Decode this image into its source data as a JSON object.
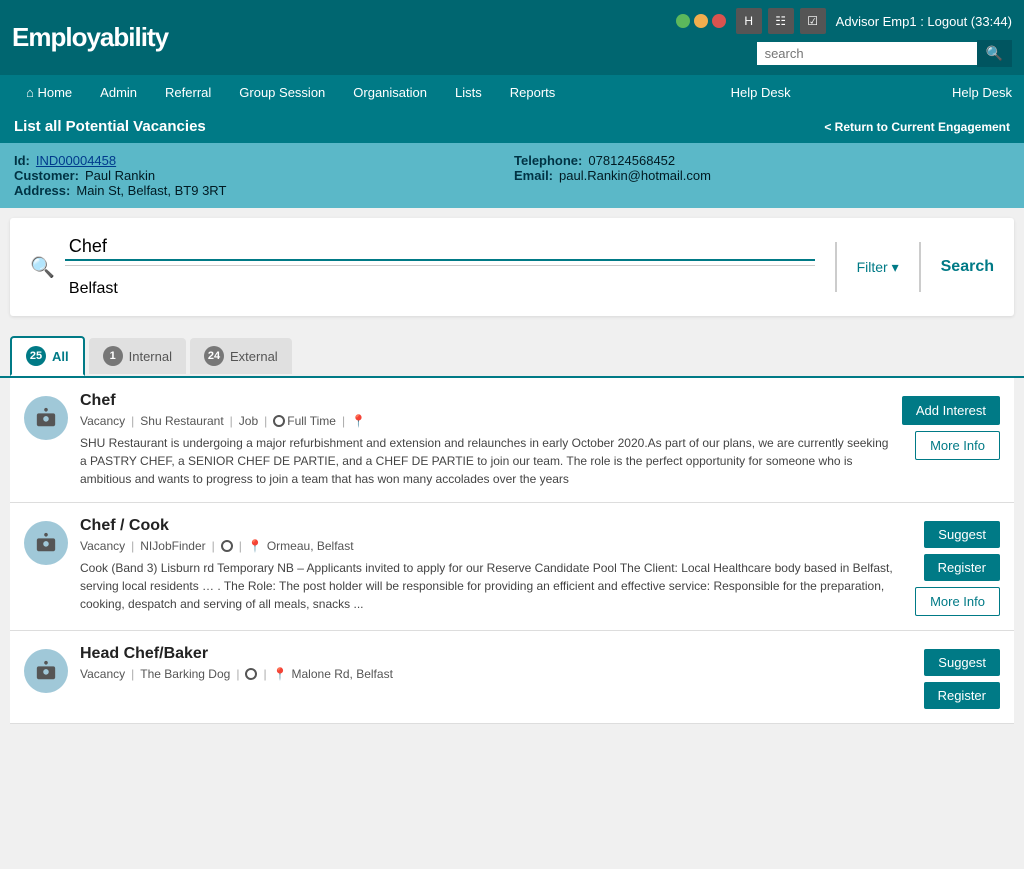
{
  "app": {
    "logo": "Employability",
    "traffic_lights": [
      "green",
      "yellow",
      "red"
    ],
    "header_icons": [
      "H",
      "doc",
      "check"
    ],
    "advisor": "Advisor Emp1 : Logout (33:44)",
    "search_placeholder": "search"
  },
  "nav": {
    "home": "Home",
    "items": [
      "Admin",
      "Referral",
      "Group Session",
      "Organisation",
      "Lists",
      "Reports"
    ],
    "help": "Help Desk"
  },
  "page": {
    "title": "List all Potential Vacancies",
    "return_link": "< Return to Current Engagement"
  },
  "customer": {
    "id_label": "Id:",
    "id_value": "IND00004458",
    "customer_label": "Customer:",
    "customer_value": "Paul Rankin",
    "address_label": "Address:",
    "address_value": "Main St, Belfast, BT9 3RT",
    "telephone_label": "Telephone:",
    "telephone_value": "078124568452",
    "email_label": "Email:",
    "email_value": "paul.Rankin@hotmail.com"
  },
  "search": {
    "job_value": "Chef",
    "location_value": "Belfast",
    "filter_label": "Filter ▾",
    "search_label": "Search"
  },
  "tabs": [
    {
      "badge": "25",
      "label": "All",
      "active": true
    },
    {
      "badge": "1",
      "label": "Internal",
      "active": false
    },
    {
      "badge": "24",
      "label": "External",
      "active": false
    }
  ],
  "vacancies": [
    {
      "title": "Chef",
      "meta_type": "Vacancy",
      "meta_source": "Shu Restaurant",
      "meta_kind": "Job",
      "meta_hours": "Full Time",
      "description": "SHU Restaurant is undergoing a major refurbishment and extension and relaunches in early October 2020.As part of our plans, we are currently seeking a PASTRY CHEF, a SENIOR CHEF DE PARTIE, and a CHEF DE PARTIE to join our team. The role is the perfect opportunity for someone who is ambitious and wants to progress to join a team that has won many accolades over the years",
      "actions": [
        "Add Interest",
        "More Info"
      ]
    },
    {
      "title": "Chef / Cook",
      "meta_type": "Vacancy",
      "meta_source": "NIJobFinder",
      "meta_location": "Ormeau, Belfast",
      "description": "Cook (Band 3) Lisburn rd Temporary NB – Applicants invited to apply for our Reserve Candidate Pool The Client: Local Healthcare body based in Belfast, serving local residents … . The Role: The post holder will be responsible for providing an efficient and effective service: Responsible for the preparation, cooking, despatch and serving of all meals, snacks ...",
      "actions": [
        "Suggest",
        "Register",
        "More Info"
      ]
    },
    {
      "title": "Head Chef/Baker",
      "meta_type": "Vacancy",
      "meta_source": "The Barking Dog",
      "meta_location": "Malone Rd, Belfast",
      "description": "",
      "actions": [
        "Suggest",
        "Register"
      ]
    }
  ],
  "buttons": {
    "add_interest": "Add Interest",
    "more_info": "More Info",
    "suggest": "Suggest",
    "register": "Register",
    "filter": "Filter ▾",
    "search": "Search"
  }
}
